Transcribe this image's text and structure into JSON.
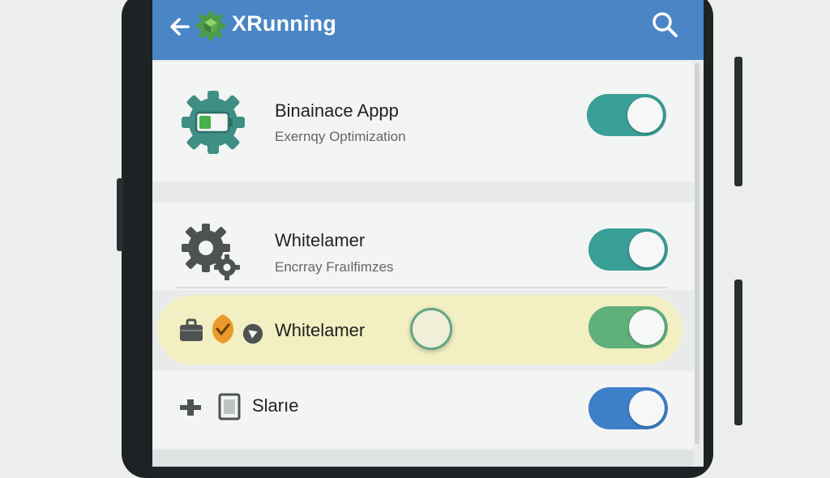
{
  "appbar": {
    "title": "XRunning",
    "back_icon": "back-arrow-icon",
    "search_icon": "search-icon",
    "color": "#4a86c6"
  },
  "rows": [
    {
      "title": "Binainace Appp",
      "subtitle": "Exernqy Optimization",
      "icon": "battery-gear-icon",
      "toggle_on": true,
      "toggle_color": "#3a9f96"
    },
    {
      "title": "Whitelamer",
      "subtitle": "Encrray Fraılfimzes",
      "icon": "gears-icon",
      "toggle_on": true,
      "toggle_color": "#3a9f96"
    },
    {
      "title": "Whitelamer",
      "icons": [
        "briefcase-icon",
        "shield-check-icon",
        "play-badge-icon"
      ],
      "toggle_on": true,
      "toggle_color": "#5fb07a",
      "highlight_color": "#f2efc2"
    },
    {
      "title": "Slarıe",
      "icons": [
        "plus-dash-icon",
        "document-icon"
      ],
      "toggle_on": true,
      "toggle_color": "#3d7fc8"
    }
  ]
}
